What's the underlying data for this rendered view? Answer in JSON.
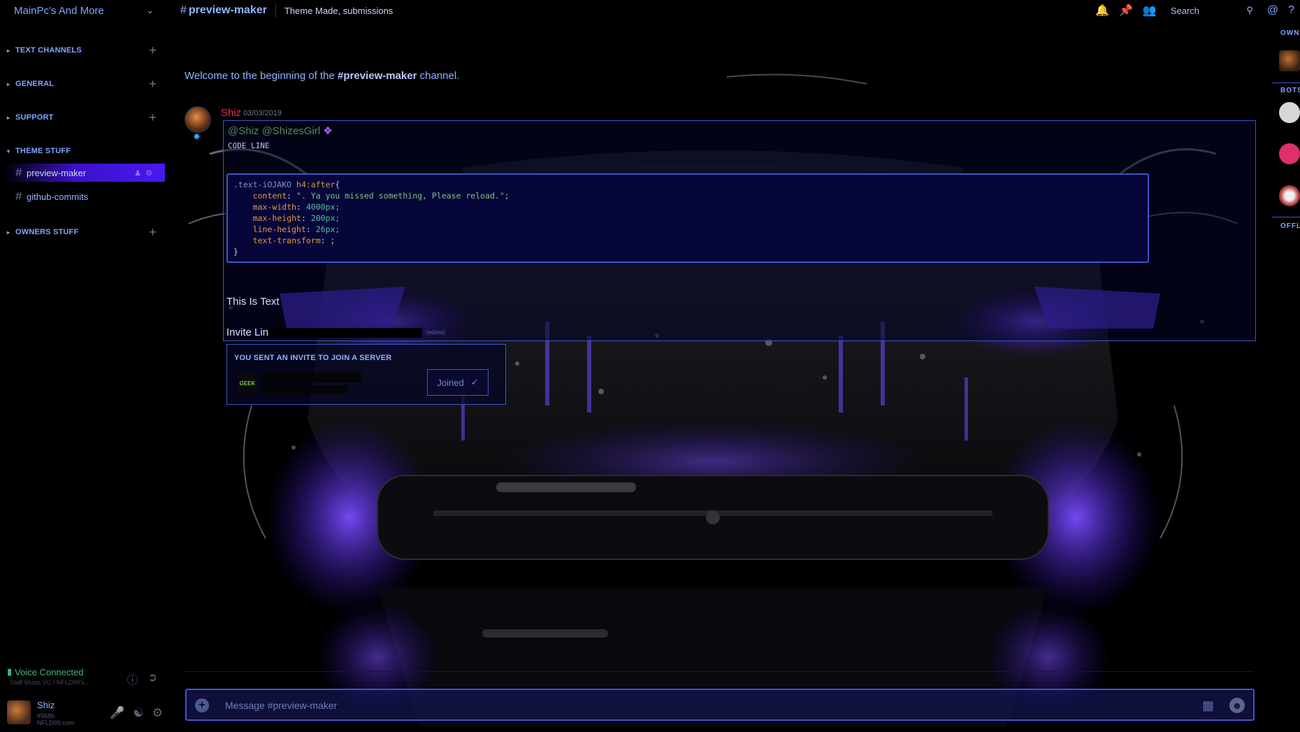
{
  "server": {
    "name": "MainPc's And More"
  },
  "sidebar": {
    "categories": [
      {
        "label": "TEXT CHANNELS"
      },
      {
        "label": "GENERAL"
      },
      {
        "label": "SUPPORT"
      },
      {
        "label": "THEME STUFF"
      },
      {
        "label": "OWNERS STUFF"
      }
    ],
    "channels": [
      {
        "label": "preview-maker",
        "active": true
      },
      {
        "label": "github-commits",
        "active": false
      }
    ]
  },
  "voice": {
    "status": "Voice Connected",
    "sub": "Staff Music VC / NFLD99's..."
  },
  "user": {
    "name": "Shiz",
    "tag": "#9686",
    "sub": "NFLD99.com"
  },
  "header": {
    "hash": "#",
    "channel": "preview-maker",
    "topic": "Theme Made, submissions",
    "search_placeholder": "Search"
  },
  "chat": {
    "welcome_pre": "Welcome to the beginning of the ",
    "welcome_channel": "#preview-maker",
    "welcome_post": " channel.",
    "message": {
      "author": "Shiz",
      "timestamp": "03/03/2019",
      "mention": "@Shiz @ShizesGirl",
      "inline_code": "CODE LINE",
      "code": {
        "selector": ".text-iOJAKO",
        "pseudo": "h4:after",
        "open": "{",
        "content_prop": "content",
        "content_val": "\". Ya you missed something, Please reload.\";",
        "maxw_prop": "max-width",
        "maxw_val": "4000px;",
        "maxh_prop": "max-height",
        "maxh_val": "200px;",
        "lh_prop": "line-height",
        "lh_val": "26px;",
        "tt_prop": "text-transform",
        "tt_val": ";",
        "close": "}"
      },
      "plain_text": "This Is Text",
      "invite_text": "Invite Lin",
      "edited": "(edited)"
    },
    "invite": {
      "title": "YOU SENT AN INVITE TO JOIN A SERVER",
      "icon_text": "GEEK",
      "button": "Joined"
    },
    "composer_placeholder": "Message #preview-maker"
  },
  "members": {
    "headers": [
      "OWN",
      "BOTS",
      "OFFL"
    ]
  },
  "colors": {
    "accent": "#3c55c8",
    "active_channel": "#4a18f0",
    "author": "#e0304a",
    "voice": "#43b581"
  }
}
